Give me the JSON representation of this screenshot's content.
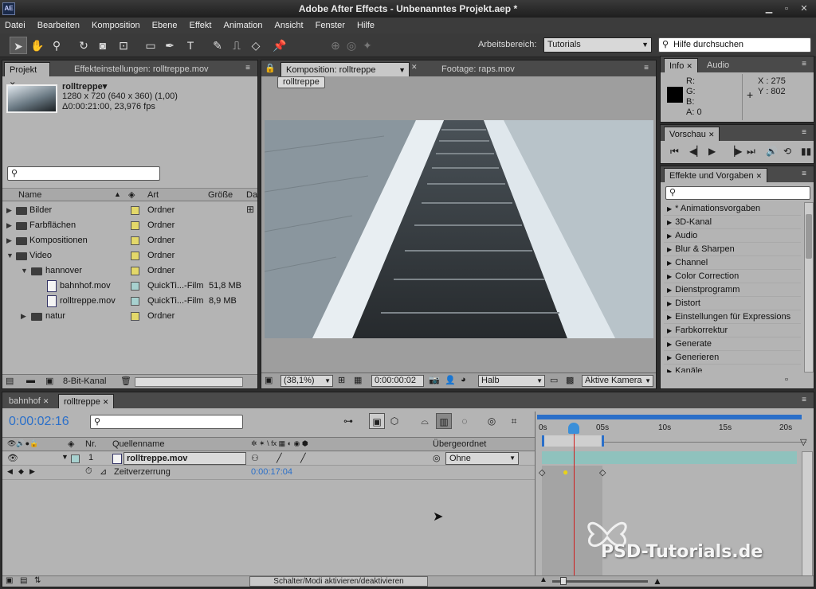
{
  "app": {
    "title": "Adobe After Effects - Unbenanntes Projekt.aep *",
    "icon_label": "AE"
  },
  "menu": [
    "Datei",
    "Bearbeiten",
    "Komposition",
    "Ebene",
    "Effekt",
    "Animation",
    "Ansicht",
    "Fenster",
    "Hilfe"
  ],
  "toolbar": {
    "workspace_label": "Arbeitsbereich:",
    "workspace_value": "Tutorials",
    "help_placeholder": "Hilfe durchsuchen"
  },
  "project": {
    "tab_project": "Projekt",
    "tab_effects": "Effekteinstellungen: rolltreppe.mov",
    "item_name": "rolltreppe▾",
    "item_size": "1280 x 720 (640 x 360) (1,00)",
    "item_duration": "Δ0:00:21:00, 23,976 fps",
    "columns": {
      "name": "Name",
      "type": "Art",
      "size": "Größe",
      "extra": "Da"
    },
    "rows": [
      {
        "name": "Bilder",
        "type": "Ordner",
        "size": ""
      },
      {
        "name": "Farbflächen",
        "type": "Ordner",
        "size": ""
      },
      {
        "name": "Kompositionen",
        "type": "Ordner",
        "size": ""
      },
      {
        "name": "Video",
        "type": "Ordner",
        "size": ""
      },
      {
        "name": "hannover",
        "type": "Ordner",
        "size": ""
      },
      {
        "name": "bahnhof.mov",
        "type": "QuickTi...-Film",
        "size": "51,8 MB"
      },
      {
        "name": "rolltreppe.mov",
        "type": "QuickTi...-Film",
        "size": "8,9 MB"
      },
      {
        "name": "natur",
        "type": "Ordner",
        "size": ""
      }
    ],
    "bitdepth": "8-Bit-Kanal"
  },
  "composition": {
    "tab_comp": "Komposition: rolltreppe",
    "tab_footage": "Footage: raps.mov",
    "breadcrumb": "rolltreppe",
    "zoom": "(38,1%)",
    "timecode": "0:00:00:02",
    "resolution": "Halb",
    "camera": "Aktive Kamera"
  },
  "info": {
    "tab_info": "Info",
    "tab_audio": "Audio",
    "r": "R:",
    "g": "G:",
    "b": "B:",
    "a": "A:  0",
    "x": "X : 275",
    "y": "Y : 802"
  },
  "preview": {
    "tab": "Vorschau"
  },
  "effects": {
    "tab": "Effekte und Vorgaben",
    "items": [
      "* Animationsvorgaben",
      "3D-Kanal",
      "Audio",
      "Blur & Sharpen",
      "Channel",
      "Color Correction",
      "Dienstprogramm",
      "Distort",
      "Einstellungen für Expressions",
      "Farbkorrektur",
      "Generate",
      "Generieren",
      "Kanäle"
    ]
  },
  "timeline": {
    "tab1": "bahnhof",
    "tab2": "rolltreppe",
    "timecode": "0:00:02:16",
    "col_nr": "Nr.",
    "col_source": "Quellenname",
    "col_parent": "Übergeordnet",
    "layer_nr": "1",
    "layer_name": "rolltreppe.mov",
    "parent_value": "Ohne",
    "prop_name": "Zeitverzerrung",
    "prop_value": "0:00:17:04",
    "ruler": [
      "0s",
      "05s",
      "10s",
      "15s",
      "20s"
    ],
    "toggle_label": "Schalter/Modi aktivieren/deaktivieren"
  },
  "watermark": "PSD-Tutorials.de",
  "colors": {
    "accent": "#2a6fc9",
    "playhead": "#d01c1c",
    "label_yellow": "#e3d86a",
    "label_teal": "#a7d1cf"
  }
}
